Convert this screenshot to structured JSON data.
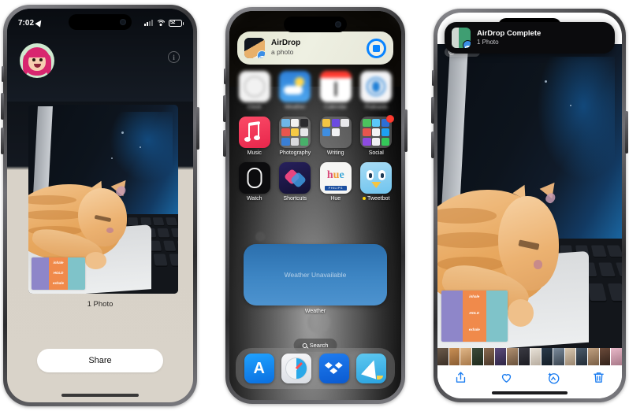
{
  "caption": "Three iPhone screenshots showing an AirDrop photo transfer: sending sheet, receiving home screen with AirDrop banner, and AirDrop Complete confirmation in Photos.",
  "phone1": {
    "name": "airdrop-share-sheet",
    "status_bar": {
      "time": "7:02",
      "location_icon": "location-arrow-icon",
      "cellular_icon": "cellular-bars-icon",
      "wifi_icon": "wifi-icon",
      "battery_icon": "battery-icon",
      "battery_text": "52"
    },
    "avatar_icon": "memoji-avatar",
    "info_icon": "info-circle-icon",
    "photo_alt": "orange tabby kitten asleep on a laptop keyboard",
    "sticker_lines": [
      "inhale",
      "HOLD",
      "exhale"
    ],
    "caption_text": "1 Photo",
    "share_button": "Share"
  },
  "phone2": {
    "name": "home-screen-receiving",
    "banner": {
      "title": "AirDrop",
      "subtitle": "a photo",
      "thumb_icon": "photo-thumbnail",
      "badge_icon": "airdrop-icon",
      "progress_icon": "progress-ring-stop-icon"
    },
    "blurred_row": [
      {
        "label": "Clock",
        "icon": "clock-icon"
      },
      {
        "label": "Weather",
        "icon": "weather-icon"
      },
      {
        "label": "Calendar",
        "icon": "calendar-icon"
      },
      {
        "label": "Podcasts",
        "icon": "podcasts-icon"
      }
    ],
    "apps_row2": [
      {
        "label": "Music",
        "icon": "music-icon",
        "badge": false
      },
      {
        "label": "Photography",
        "icon": "folder-icon",
        "badge": false
      },
      {
        "label": "Writing",
        "icon": "folder-icon",
        "badge": false
      },
      {
        "label": "Social",
        "icon": "folder-icon",
        "badge": true
      }
    ],
    "apps_row3": [
      {
        "label": "Watch",
        "icon": "watch-icon",
        "dot": false
      },
      {
        "label": "Shortcuts",
        "icon": "shortcuts-icon",
        "dot": false
      },
      {
        "label": "Hue",
        "icon": "hue-icon",
        "dot": false,
        "sub": "PHILIPS"
      },
      {
        "label": "Tweetbot",
        "icon": "tweetbot-icon",
        "dot": true
      }
    ],
    "widget": {
      "text": "Weather Unavailable",
      "label": "Weather"
    },
    "search": {
      "label": "Search",
      "icon": "magnifier-icon"
    },
    "dock": [
      {
        "label": "App Store",
        "icon": "app-store-icon"
      },
      {
        "label": "Safari",
        "icon": "safari-icon"
      },
      {
        "label": "Dropbox",
        "icon": "dropbox-icon"
      },
      {
        "label": "Spark",
        "icon": "spark-mail-icon"
      }
    ]
  },
  "phone3": {
    "name": "photos-airdrop-complete",
    "banner": {
      "title": "AirDrop Complete",
      "subtitle": "1 Photo",
      "thumb_icon": "photo-thumbnail",
      "badge_icon": "airdrop-icon"
    },
    "live_badge": {
      "label": "LIVE",
      "icon": "live-photo-icon",
      "chevron_icon": "chevron-down-icon"
    },
    "photo_alt": "orange tabby kitten asleep on a laptop keyboard",
    "toolbar": [
      {
        "name": "share-button",
        "icon": "share-up-arrow-icon"
      },
      {
        "name": "favorite-button",
        "icon": "heart-icon"
      },
      {
        "name": "edit-button",
        "icon": "magic-wand-icon"
      },
      {
        "name": "delete-button",
        "icon": "trash-icon"
      }
    ]
  },
  "colors": {
    "ios_blue": "#0a84ff",
    "toolbar_blue": "#1a7cf0",
    "badge_red": "#ff3b30",
    "banner_green": "#e4e7d3",
    "sheet_beige": "#d9d3c9"
  }
}
